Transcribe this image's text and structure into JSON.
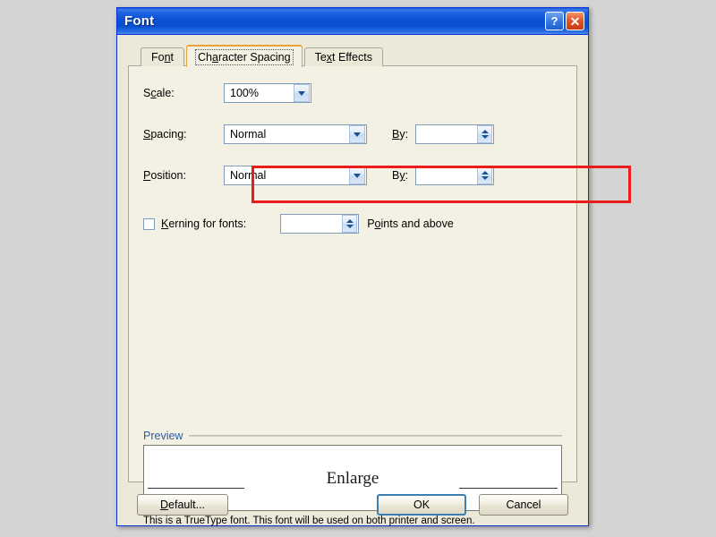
{
  "window": {
    "title": "Font",
    "help_button": "?",
    "close_button": "✕"
  },
  "tabs": [
    {
      "label": "Font",
      "mnemonic": "n",
      "active": false
    },
    {
      "label": "Character Spacing",
      "mnemonic": "a",
      "active": true
    },
    {
      "label": "Text Effects",
      "mnemonic": "x",
      "active": false
    }
  ],
  "form": {
    "scale": {
      "label": "Scale:",
      "label_pre": "S",
      "label_mnemonic": "c",
      "label_post": "ale:",
      "value": "100%"
    },
    "spacing": {
      "label": "Spacing:",
      "label_mnemonic": "S",
      "label_post": "pacing:",
      "value": "Normal",
      "by_label_mnemonic": "B",
      "by_label_post": "y:",
      "by_value": ""
    },
    "position": {
      "label": "Position:",
      "label_mnemonic": "P",
      "label_post": "osition:",
      "value": "Normal",
      "by_label_pre": "B",
      "by_label_mnemonic": "y",
      "by_label_post": ":",
      "by_value": ""
    },
    "kerning": {
      "checked": false,
      "label_mnemonic": "K",
      "label_post": "erning for fonts:",
      "value": "",
      "points_pre": "P",
      "points_mnemonic": "o",
      "points_post": "ints and above"
    }
  },
  "preview": {
    "legend": "Preview",
    "sample_text": "Enlarge",
    "note": "This is a TrueType font. This font will be used on both printer and screen."
  },
  "buttons": {
    "default": "Default...",
    "default_pre": "D",
    "default_mnemonic": "",
    "default_post": "efault...",
    "ok": "OK",
    "cancel": "Cancel"
  },
  "annotation": {
    "highlight_color": "#ec1c1c",
    "highlight_target": "spacing-row"
  },
  "colors": {
    "desktop_background": "#d4d4d4",
    "title_bar": "#0a51d6",
    "dialog_face": "#ece9d8",
    "tab_panel": "#f3f1e4",
    "active_tab_border": "#e8a33d",
    "field_border": "#7f9db9",
    "legend_text": "#2d5c9e",
    "highlight": "#ec1c1c"
  }
}
